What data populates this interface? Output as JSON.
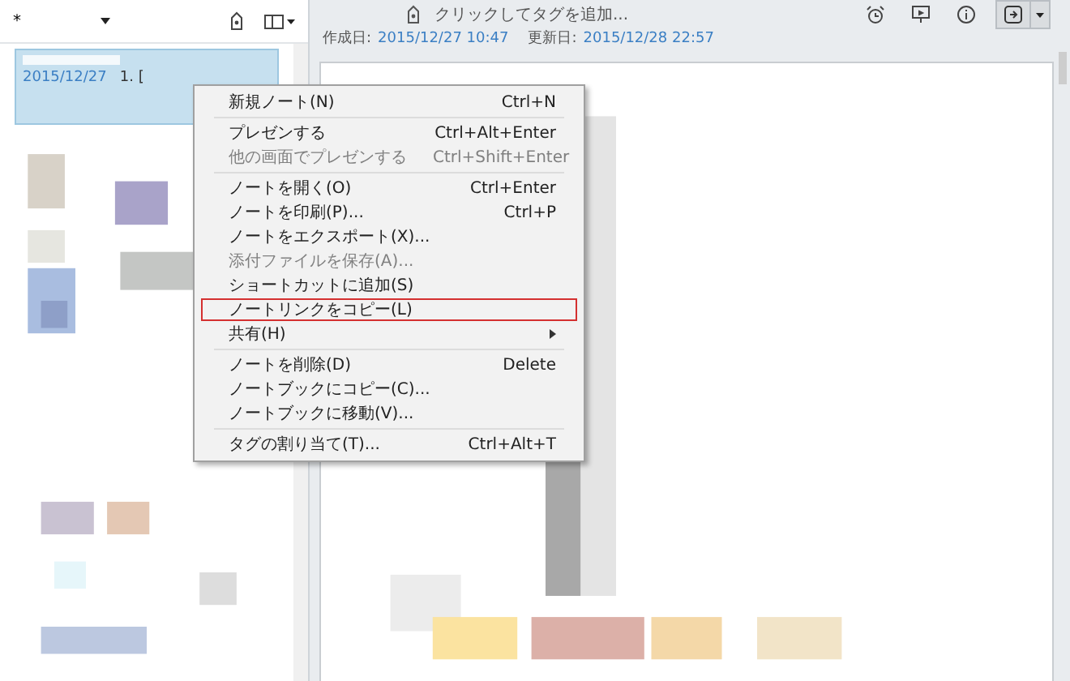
{
  "notebook_selector": {
    "label": "*"
  },
  "notes": [
    {
      "date": "2015/12/27",
      "snippet": "1. [",
      "selected": true
    }
  ],
  "tag_bar": {
    "placeholder": "クリックしてタグを追加..."
  },
  "meta": {
    "created_label": "作成日:",
    "created": "2015/12/27 10:47",
    "updated_label": "更新日:",
    "updated": "2015/12/28 22:57"
  },
  "context_menu": [
    {
      "kind": "item",
      "label": "新規ノート(N)",
      "shortcut": "Ctrl+N",
      "disabled": false,
      "outlined": false
    },
    {
      "kind": "separator"
    },
    {
      "kind": "item",
      "label": "プレゼンする",
      "shortcut": "Ctrl+Alt+Enter",
      "disabled": false,
      "outlined": false
    },
    {
      "kind": "item",
      "label": "他の画面でプレゼンする",
      "shortcut": "Ctrl+Shift+Enter",
      "disabled": true,
      "outlined": false
    },
    {
      "kind": "separator"
    },
    {
      "kind": "item",
      "label": "ノートを開く(O)",
      "shortcut": "Ctrl+Enter",
      "disabled": false,
      "outlined": false
    },
    {
      "kind": "item",
      "label": "ノートを印刷(P)...",
      "shortcut": "Ctrl+P",
      "disabled": false,
      "outlined": false
    },
    {
      "kind": "item",
      "label": "ノートをエクスポート(X)...",
      "disabled": false,
      "outlined": false
    },
    {
      "kind": "item",
      "label": "添付ファイルを保存(A)...",
      "disabled": true,
      "outlined": false
    },
    {
      "kind": "item",
      "label": "ショートカットに追加(S)",
      "disabled": false,
      "outlined": false
    },
    {
      "kind": "item",
      "label": "ノートリンクをコピー(L)",
      "disabled": false,
      "outlined": true
    },
    {
      "kind": "submenu",
      "label": "共有(H)",
      "disabled": false,
      "outlined": false
    },
    {
      "kind": "separator"
    },
    {
      "kind": "item",
      "label": "ノートを削除(D)",
      "shortcut": "Delete",
      "disabled": false,
      "outlined": false
    },
    {
      "kind": "item",
      "label": "ノートブックにコピー(C)...",
      "disabled": false,
      "outlined": false
    },
    {
      "kind": "item",
      "label": "ノートブックに移動(V)...",
      "disabled": false,
      "outlined": false
    },
    {
      "kind": "separator"
    },
    {
      "kind": "item",
      "label": "タグの割り当て(T)...",
      "shortcut": "Ctrl+Alt+T",
      "disabled": false,
      "outlined": false
    }
  ]
}
